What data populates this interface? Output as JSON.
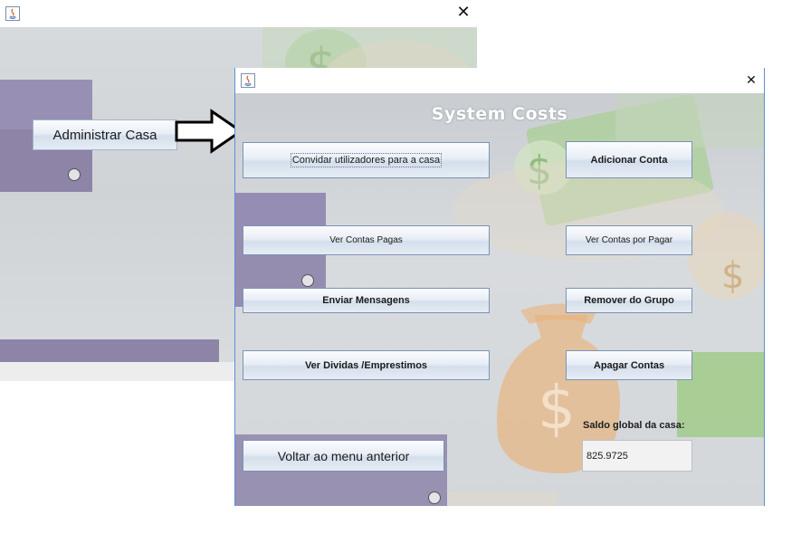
{
  "back_window": {
    "close_glyph": "✕",
    "administrar_label": "Administrar Casa"
  },
  "front_window": {
    "close_glyph": "✕",
    "app_title": "System Costs",
    "buttons": {
      "convidar": "Convidar utilizadores para a casa",
      "adicionar": "Adicionar Conta",
      "ver_pagas": "Ver Contas Pagas",
      "ver_por_pagar": "Ver Contas por Pagar",
      "enviar": "Enviar Mensagens",
      "remover": "Remover do Grupo",
      "ver_dividas": "Ver Dividas /Emprestimos",
      "apagar": "Apagar Contas",
      "voltar": "Voltar ao menu anterior"
    },
    "saldo_label": "Saldo global da casa:",
    "saldo_value": "825.9725"
  },
  "colors": {
    "accent_border": "#5b8fd6",
    "money_green": "#9cc98a",
    "purple_panel": "#8a7fa8"
  }
}
